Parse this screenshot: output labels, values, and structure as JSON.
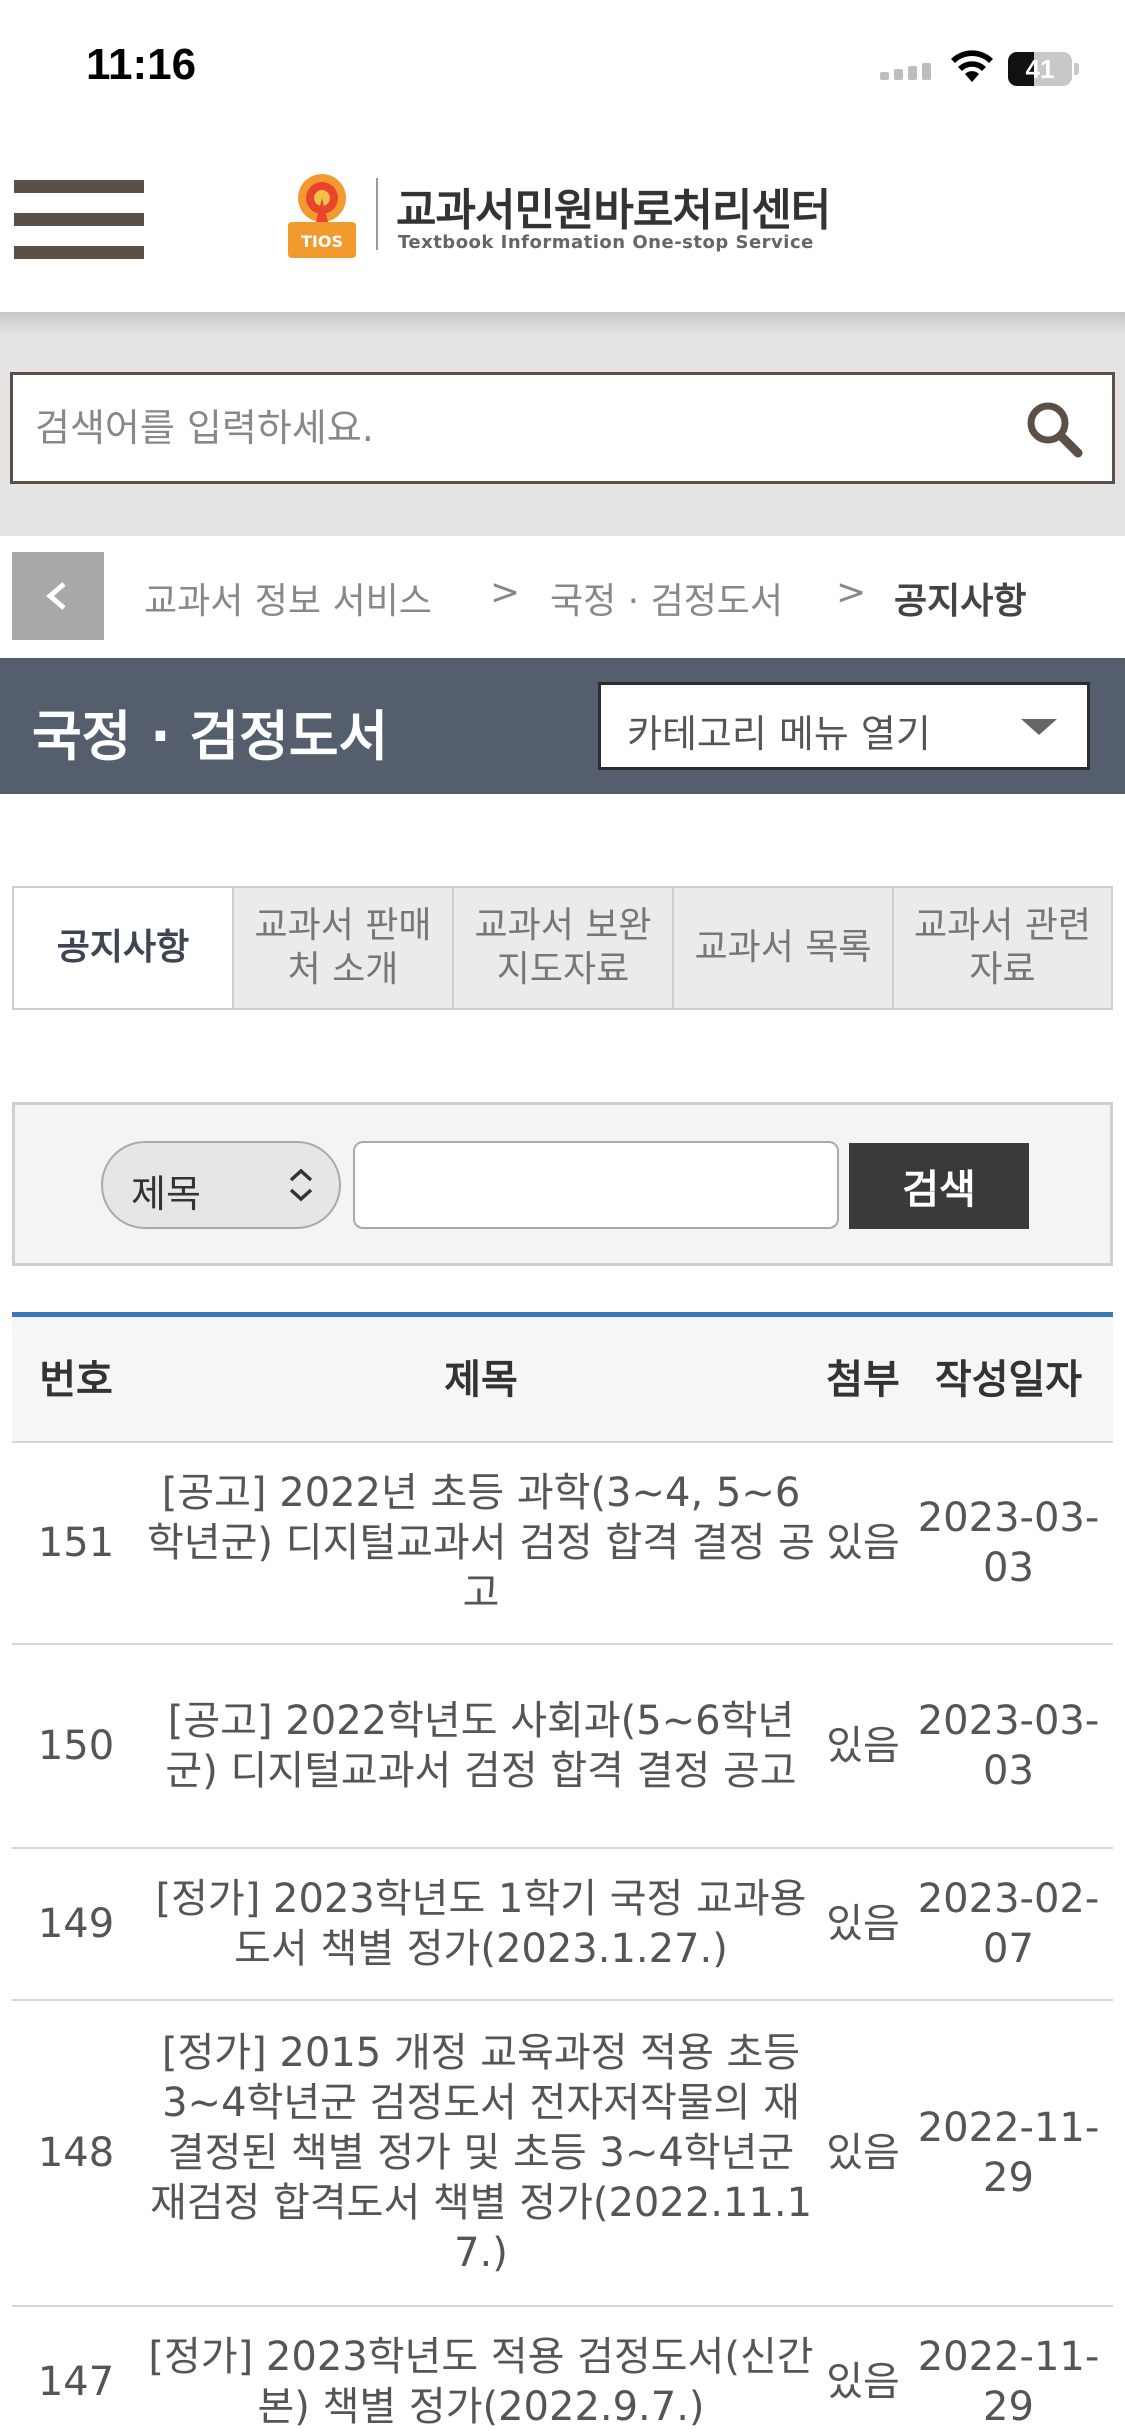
{
  "status_bar": {
    "time": "11:16",
    "battery": "41",
    "battery_level": 0.41
  },
  "header": {
    "logo_title": "교과서민원바로처리센터",
    "logo_subtitle": "Textbook Information One-stop Service",
    "logo_mark_text": "TIOS"
  },
  "search": {
    "placeholder": "검색어를 입력하세요."
  },
  "breadcrumb": {
    "items": [
      "교과서 정보 서비스",
      "국정 · 검정도서",
      "공지사항"
    ],
    "separator": ">"
  },
  "section": {
    "title": "국정 · 검정도서",
    "category_button": "카테고리 메뉴 열기"
  },
  "tabs": [
    {
      "label": "공지사항",
      "active": true
    },
    {
      "label": "교과서 판매처 소개",
      "active": false
    },
    {
      "label": "교과서 보완 지도자료",
      "active": false
    },
    {
      "label": "교과서 목록",
      "active": false
    },
    {
      "label": "교과서 관련 자료",
      "active": false
    }
  ],
  "search_form": {
    "select_value": "제목",
    "keyword_value": "",
    "button_label": "검색"
  },
  "table": {
    "columns": [
      "번호",
      "제목",
      "첨부",
      "작성일자"
    ],
    "rows": [
      {
        "no": "151",
        "title": "[공고] 2022년 초등 과학(3~4, 5~6학년군) 디지털교과서 검정 합격 결정 공고",
        "attachment": "있음",
        "date": "2023-03-03"
      },
      {
        "no": "150",
        "title": "[공고] 2022학년도 사회과(5~6학년군) 디지털교과서 검정 합격 결정 공고",
        "attachment": "있음",
        "date": "2023-03-03"
      },
      {
        "no": "149",
        "title": "[정가] 2023학년도 1학기 국정 교과용도서 책별 정가(2023.1.27.)",
        "attachment": "있음",
        "date": "2023-02-07"
      },
      {
        "no": "148",
        "title": "[정가] 2015 개정 교육과정 적용 초등 3~4학년군 검정도서 전자저작물의 재결정된 책별 정가 및 초등 3~4학년군 재검정 합격도서 책별 정가(2022.11.17.)",
        "attachment": "있음",
        "date": "2022-11-29"
      },
      {
        "no": "147",
        "title": "[정가] 2023학년도 적용 검정도서(신간본) 책별 정가(2022.9.7.)",
        "attachment": "있음",
        "date": "2022-11-29"
      }
    ]
  },
  "colors": {
    "section_bar": "#545e6c",
    "brand_brown": "#5b4f47",
    "table_accent": "#3d77b8",
    "search_button": "#3a3a3a"
  }
}
